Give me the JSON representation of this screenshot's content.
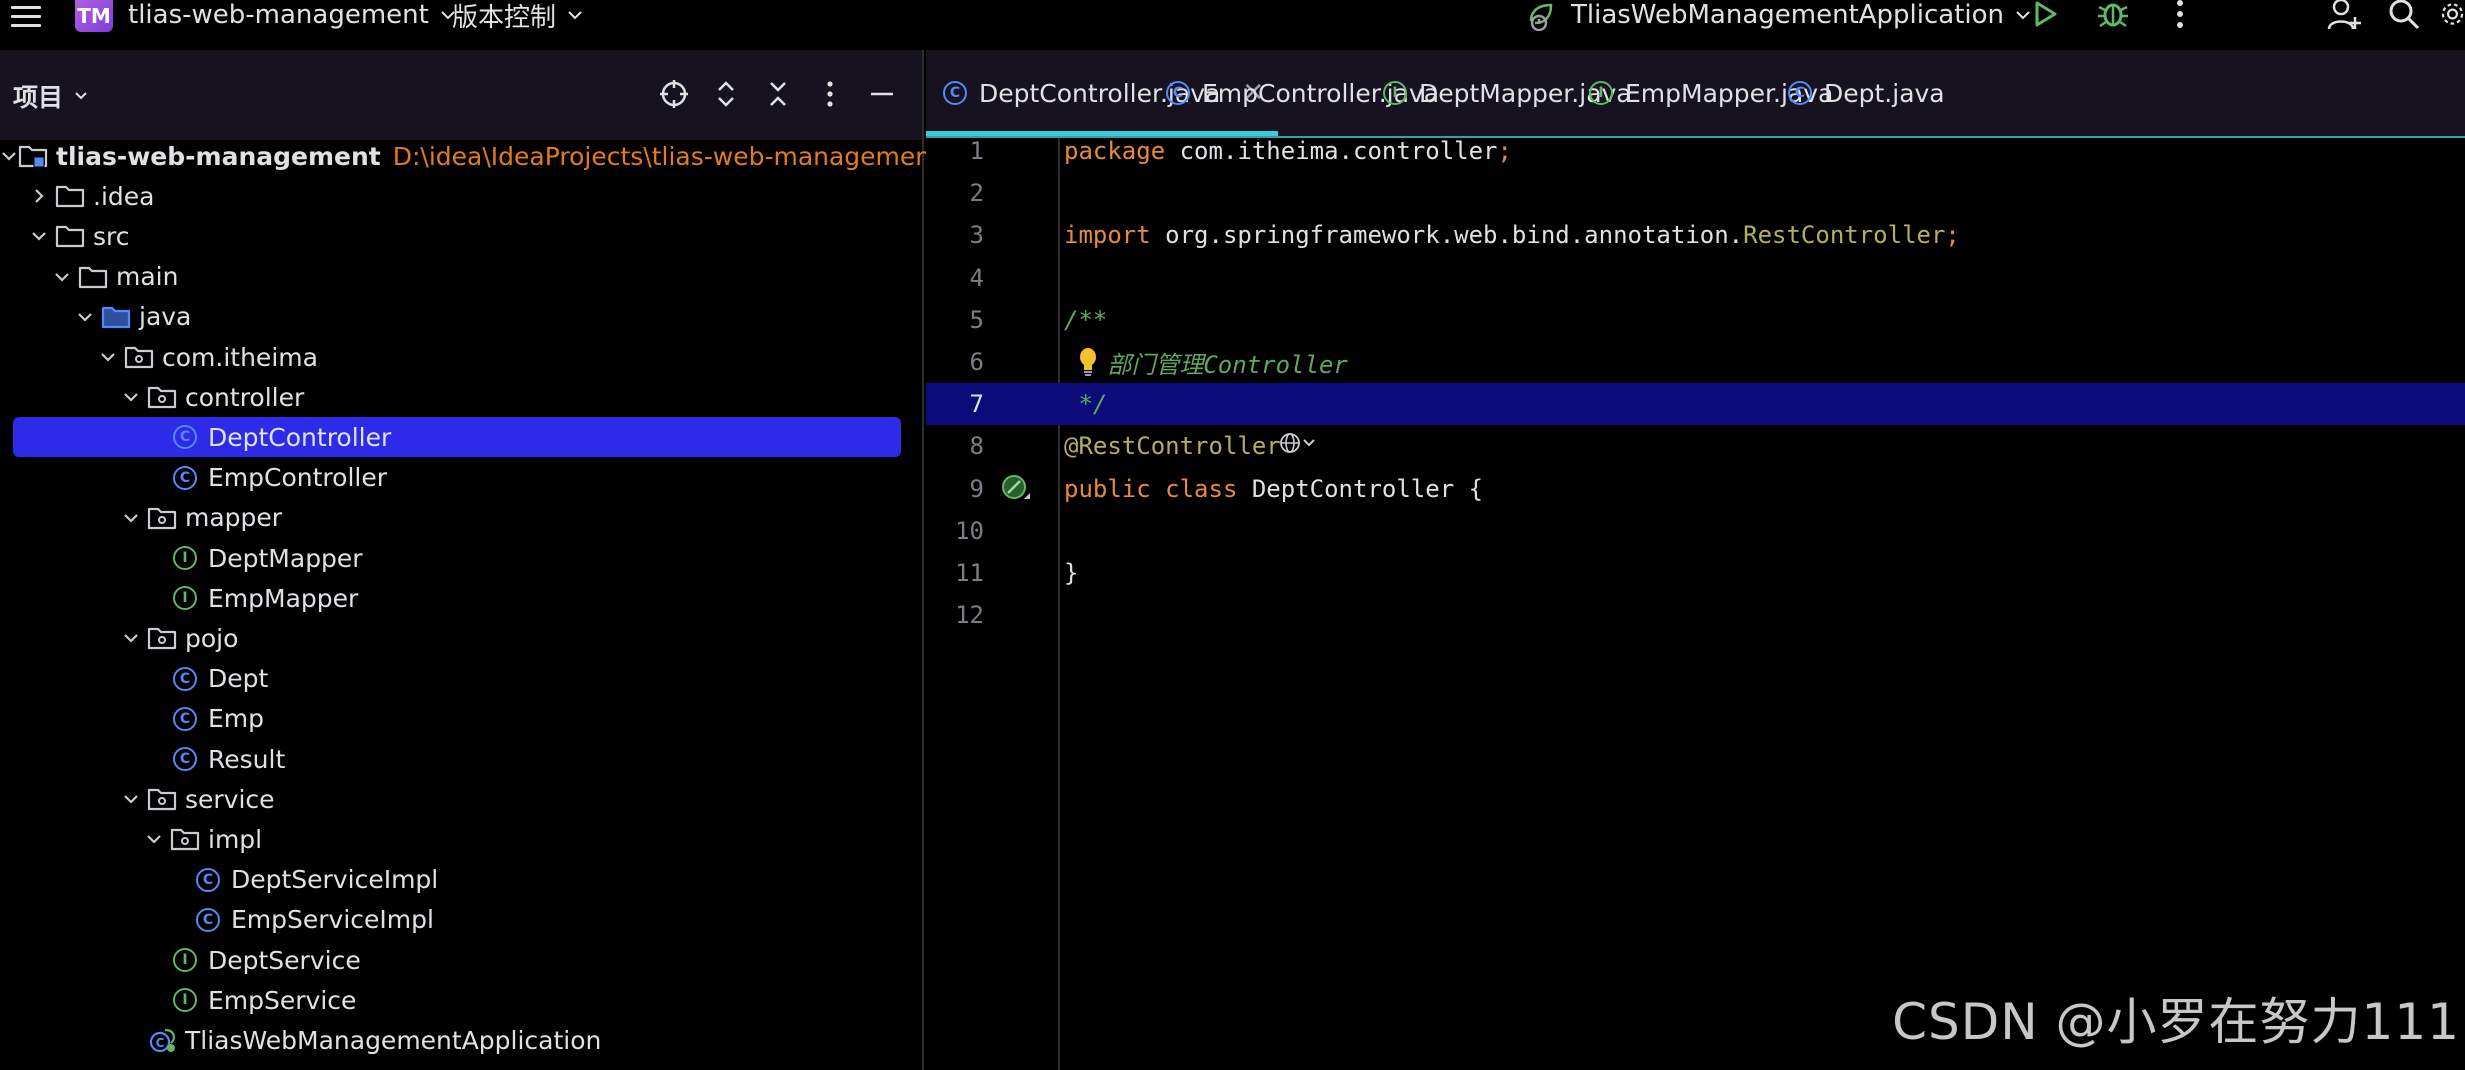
{
  "titlebar": {
    "project_badge": "TM",
    "project_name": "tlias-web-management",
    "vcs_label": "版本控制",
    "run_config": "TliasWebManagementApplication"
  },
  "project_panel": {
    "title": "项目",
    "tree": [
      {
        "label": "tlias-web-management",
        "path": "D:\\idea\\IdeaProjects\\tlias-web-management",
        "kind": "module",
        "expanded": true,
        "bold": true
      },
      {
        "label": ".idea",
        "kind": "folder",
        "expanded": false
      },
      {
        "label": "src",
        "kind": "folder",
        "expanded": true
      },
      {
        "label": "main",
        "kind": "folder",
        "expanded": true
      },
      {
        "label": "java",
        "kind": "source-folder",
        "expanded": true
      },
      {
        "label": "com.itheima",
        "kind": "package",
        "expanded": true
      },
      {
        "label": "controller",
        "kind": "package",
        "expanded": true
      },
      {
        "label": "DeptController",
        "kind": "class",
        "selected": true
      },
      {
        "label": "EmpController",
        "kind": "class"
      },
      {
        "label": "mapper",
        "kind": "package",
        "expanded": true
      },
      {
        "label": "DeptMapper",
        "kind": "interface"
      },
      {
        "label": "EmpMapper",
        "kind": "interface"
      },
      {
        "label": "pojo",
        "kind": "package",
        "expanded": true
      },
      {
        "label": "Dept",
        "kind": "class"
      },
      {
        "label": "Emp",
        "kind": "class"
      },
      {
        "label": "Result",
        "kind": "class"
      },
      {
        "label": "service",
        "kind": "package",
        "expanded": true
      },
      {
        "label": "impl",
        "kind": "package",
        "expanded": true
      },
      {
        "label": "DeptServiceImpl",
        "kind": "class"
      },
      {
        "label": "EmpServiceImpl",
        "kind": "class"
      },
      {
        "label": "DeptService",
        "kind": "interface"
      },
      {
        "label": "EmpService",
        "kind": "interface"
      },
      {
        "label": "TliasWebManagementApplication",
        "kind": "spring-class"
      }
    ]
  },
  "editor": {
    "tabs": [
      {
        "label": "DeptController.java",
        "icon": "class-icon",
        "active": true,
        "closable": true
      },
      {
        "label": "EmpController.java",
        "icon": "class-icon"
      },
      {
        "label": "DeptMapper.java",
        "icon": "interface-icon"
      },
      {
        "label": "EmpMapper.java",
        "icon": "interface-icon"
      },
      {
        "label": "Dept.java",
        "icon": "class-icon"
      }
    ],
    "current_line": 7,
    "lines": [
      {
        "n": "1",
        "tokens": [
          {
            "t": "package",
            "c": "kw"
          },
          {
            "t": " com.itheima.controller",
            "c": ""
          },
          {
            "t": ";",
            "c": "semi"
          }
        ]
      },
      {
        "n": "2",
        "tokens": []
      },
      {
        "n": "3",
        "tokens": [
          {
            "t": "import",
            "c": "kw"
          },
          {
            "t": " org.springframework.web.bind.annotation.",
            "c": ""
          },
          {
            "t": "RestController",
            "c": "ann"
          },
          {
            "t": ";",
            "c": "semi"
          }
        ]
      },
      {
        "n": "4",
        "tokens": []
      },
      {
        "n": "5",
        "tokens": [
          {
            "t": "/**",
            "c": "cmt"
          }
        ]
      },
      {
        "n": "6",
        "tokens": [
          {
            "t": "   部门管理Controller",
            "c": "cmt"
          }
        ]
      },
      {
        "n": "7",
        "tokens": [
          {
            "t": " */",
            "c": "cmt"
          }
        ]
      },
      {
        "n": "8",
        "tokens": [
          {
            "t": "@RestController",
            "c": "ann"
          }
        ]
      },
      {
        "n": "9",
        "tokens": [
          {
            "t": "public",
            "c": "kw"
          },
          {
            "t": " ",
            "c": ""
          },
          {
            "t": "class",
            "c": "kw"
          },
          {
            "t": " DeptController {",
            "c": ""
          }
        ]
      },
      {
        "n": "10",
        "tokens": []
      },
      {
        "n": "11",
        "tokens": [
          {
            "t": "}",
            "c": ""
          }
        ]
      },
      {
        "n": "12",
        "tokens": []
      }
    ]
  },
  "watermark": "CSDN @小罗在努力111",
  "colors": {
    "selection": "#2e2be8",
    "current_line": "#0b0b7a",
    "keyword": "#e58a3f",
    "annotation": "#b3ae60",
    "comment": "#5fa85e",
    "path": "#e07c1c",
    "tab_underline": "#3ccbd9"
  }
}
